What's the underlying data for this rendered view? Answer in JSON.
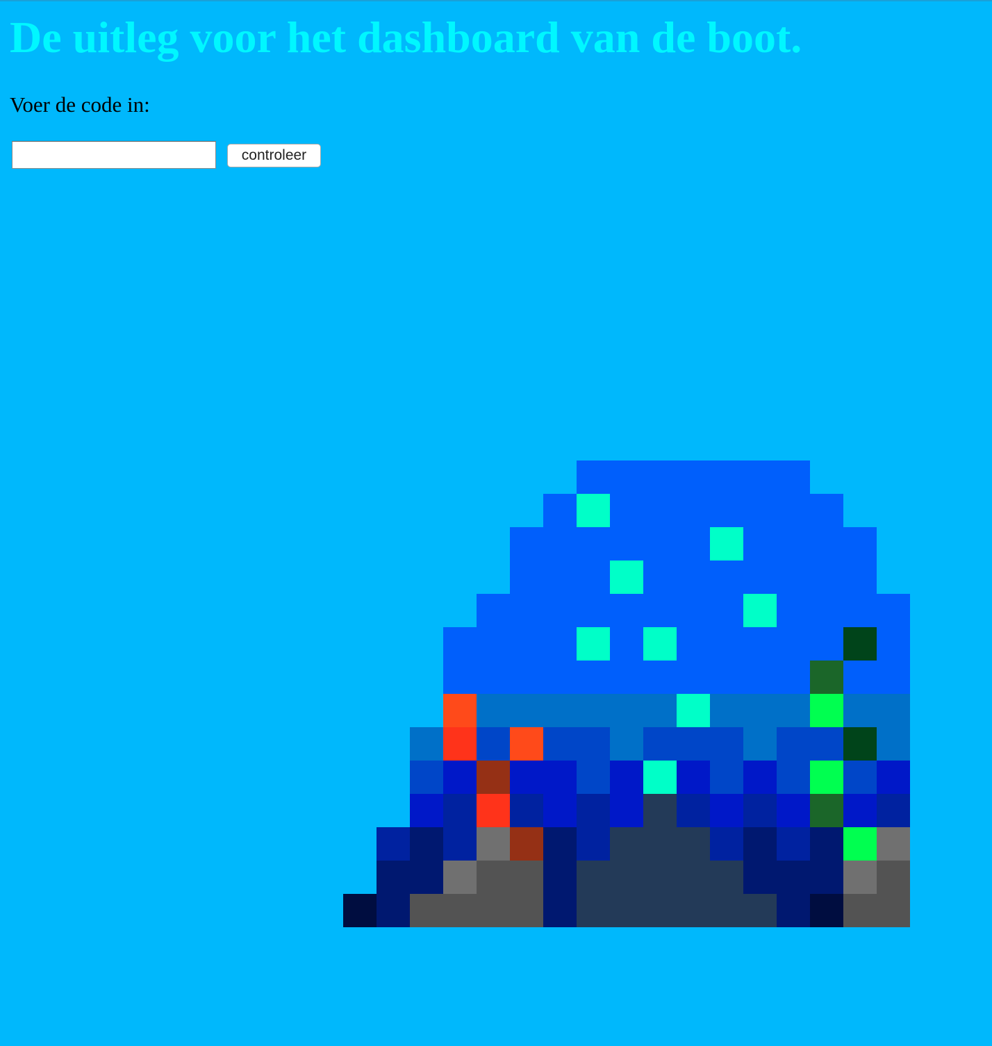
{
  "page": {
    "background_color": "#00b8fc",
    "title": "De uitleg voor het dashboard van de boot.",
    "title_color": "#00f7ff",
    "code_prompt": "Voer de code in:",
    "code_input": {
      "value": "",
      "placeholder": ""
    },
    "check_button_label": "controleer"
  },
  "pixel_image": {
    "palette": {
      "B": "#005ffc",
      "C": "#00ffc8",
      "G": "#00441a",
      "g": "#1b6629",
      "L": "#00ff50",
      "M": "#0070c8",
      "O": "#ff4a1a",
      "R": "#ff331a",
      "r": "#953015",
      "K": "#0046c8",
      "k": "#0018c8",
      "N": "#0022a0",
      "n": "#001870",
      "d": "#000d40",
      "S": "#233a58",
      "y": "#707070",
      "Y": "#535353",
      "z": "#2f2f2f",
      "Z": "#252525"
    },
    "rows": [
      "...........BBBBBBB....",
      "..........BCBBBBBBB...",
      ".........BBBBBBCBBBB..",
      ".........BBBCBBBBBBB..",
      "........BBBBBBBBCBBBB.",
      ".......BBBBCBCBBBBBGBB",
      ".......BBBBBBBBBBBgBBB",
      ".......OMMMMMMCMMMLMMM",
      "......MRKOKKMKKKMKKGMRK",
      "......KkrkkKkCkKkKLKkrK",
      "......kNRNkNkSNkNkgkNyY",
      ".....NnNyrnNSSSNnNnLyYzY",
      ".....nnyYYnSSSSSnnnyYzZY",
      "....dnYYYYnSSSSSSndYYZZYY"
    ]
  }
}
